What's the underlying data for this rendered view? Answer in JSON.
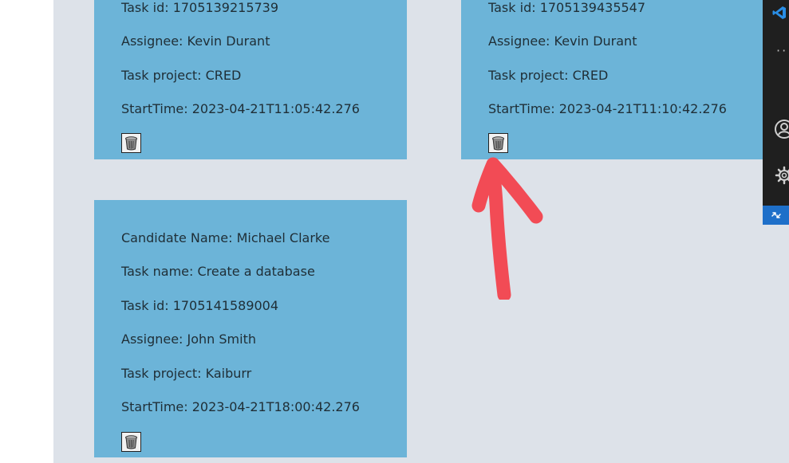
{
  "cards": [
    {
      "lines": [
        "Task id: 1705139215739",
        "Assignee: Kevin Durant",
        "Task project: CRED",
        "StartTime: 2023-04-21T11:05:42.276"
      ]
    },
    {
      "lines": [
        "Task id: 1705139435547",
        "Assignee: Kevin Durant",
        "Task project: CRED",
        "StartTime: 2023-04-21T11:10:42.276"
      ]
    },
    {
      "lines": [
        "Candidate Name: Michael Clarke",
        "Task name: Create a database",
        "Task id: 1705141589004",
        "Assignee: John Smith",
        "Task project: Kaiburr",
        "StartTime: 2023-04-21T18:00:42.276"
      ]
    }
  ],
  "icons": {
    "delete": "trash-icon",
    "annotation": "red-arrow-annotation",
    "vscode_logo": "vscode-logo-icon",
    "more": "ellipsis-icon",
    "account": "account-icon",
    "settings": "gear-icon",
    "remote": "remote-connection-icon"
  },
  "vscode": {
    "more_label": "··"
  },
  "colors": {
    "card": "#6cb4d8",
    "background": "#dde2e9",
    "arrow": "#f24b55",
    "vscode_bar": "#1f1f1f",
    "vscode_remote": "#1e6fc9"
  }
}
